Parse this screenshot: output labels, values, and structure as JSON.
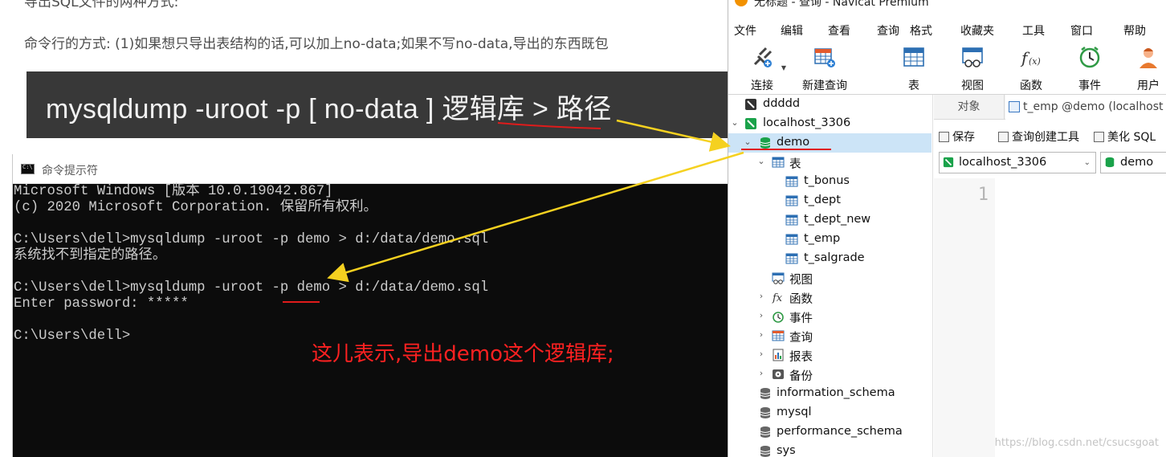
{
  "article": {
    "heading_fragment": "导出SQL文件的两种方式:",
    "intro_line": "命令行的方式: (1)如果想只导出表结构的话,可以加上no-data;如果不写no-data,导出的东西既包",
    "command_banner": {
      "part1": "mysqldump  -uroot  -p  [ no-data ]  ",
      "db_word": "逻辑库",
      "part2": " > 路径"
    }
  },
  "cmd_window": {
    "title": "命令提示符",
    "lines": [
      "Microsoft Windows [版本 10.0.19042.867]",
      "(c) 2020 Microsoft Corporation. 保留所有权利。",
      "",
      "C:\\Users\\dell>mysqldump -uroot -p demo > d:/data/demo.sql",
      "系统找不到指定的路径。",
      "",
      "C:\\Users\\dell>mysqldump -uroot -p demo > d:/data/demo.sql",
      "Enter password: *****",
      "",
      "C:\\Users\\dell>"
    ],
    "annotation": "这儿表示,导出demo这个逻辑库;"
  },
  "navicat": {
    "title": "无标题 - 查询 - Navicat Premium",
    "menu": [
      "文件",
      "编辑",
      "查看",
      "查询",
      "格式",
      "收藏夹",
      "工具",
      "窗口",
      "帮助"
    ],
    "toolbar": {
      "connect": "连接",
      "new_query": "新建查询",
      "table": "表",
      "view": "视图",
      "function": "函数",
      "event": "事件",
      "user": "用户"
    },
    "tree": {
      "conn1": "ddddd",
      "conn2": "localhost_3306",
      "db_demo": "demo",
      "tables_group": "表",
      "tables": [
        "t_bonus",
        "t_dept",
        "t_dept_new",
        "t_emp",
        "t_salgrade"
      ],
      "views": "视图",
      "functions": "函数",
      "events": "事件",
      "queries": "查询",
      "reports": "报表",
      "backups": "备份",
      "other_dbs": [
        "information_schema",
        "mysql",
        "performance_schema",
        "sys"
      ]
    },
    "tabs": {
      "objects": "对象",
      "query_tab": "t_emp @demo (localhost"
    },
    "query_toolbar": {
      "save": "保存",
      "builder": "查询创建工具",
      "beautify": "美化 SQL"
    },
    "selectors": {
      "connection": "localhost_3306",
      "database": "demo"
    },
    "editor": {
      "line_number": "1"
    },
    "watermark": "https://blog.csdn.net/csucsgoat"
  },
  "colors": {
    "annotation_red": "#ff2121",
    "arrow_yellow": "#f5d120",
    "navicat_green": "#1aa24a",
    "selection_blue": "#cce4f7"
  }
}
